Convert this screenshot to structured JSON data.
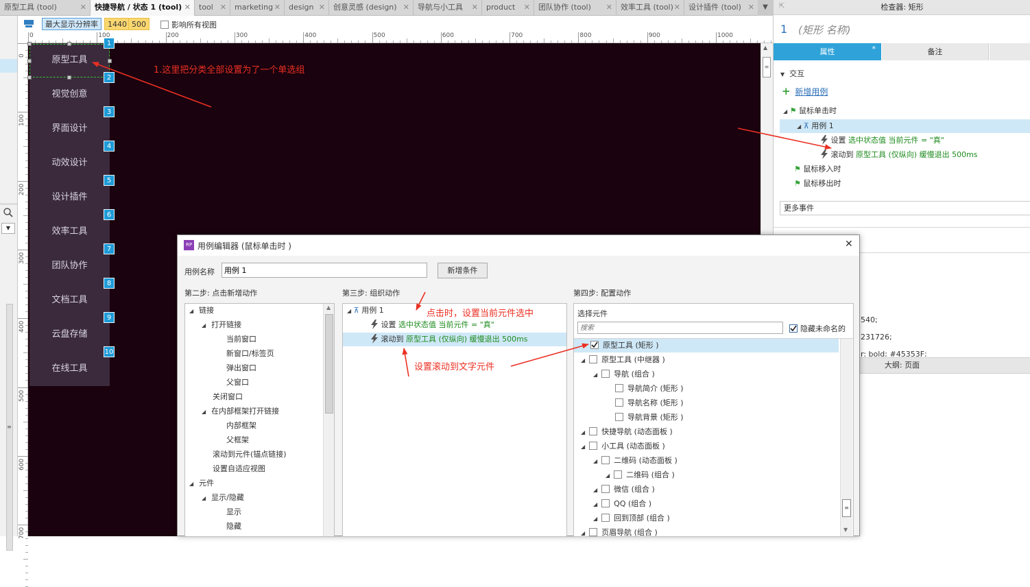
{
  "tabs": [
    {
      "label": "原型工具 (tool)",
      "active": false
    },
    {
      "label": "快捷导航 / 状态 1 (tool)",
      "active": true
    },
    {
      "label": "tool",
      "active": false
    },
    {
      "label": "marketing",
      "active": false
    },
    {
      "label": "design",
      "active": false
    },
    {
      "label": "创意灵感 (design)",
      "active": false
    },
    {
      "label": "导航与小工具",
      "active": false
    },
    {
      "label": "product",
      "active": false
    },
    {
      "label": "团队协作 (tool)",
      "active": false
    },
    {
      "label": "效率工具 (tool)",
      "active": false
    },
    {
      "label": "设计插件 (tool)",
      "active": false
    }
  ],
  "tab_close": "✕",
  "toolbar": {
    "resolution_label": "最大显示分辨率",
    "width": "1440",
    "height": "500",
    "affect_all_label": "影响所有视图"
  },
  "hruler": [
    "0",
    "100",
    "200",
    "300",
    "400",
    "500",
    "600",
    "700",
    "800",
    "900",
    "1000"
  ],
  "vruler": [
    "0",
    "100",
    "200",
    "300",
    "400",
    "500",
    "600",
    "700"
  ],
  "nav": {
    "items": [
      "原型工具",
      "视觉创意",
      "界面设计",
      "动效设计",
      "设计插件",
      "效率工具",
      "团队协作",
      "文档工具",
      "云盘存储",
      "在线工具"
    ],
    "numbers": [
      "1",
      "2",
      "3",
      "4",
      "5",
      "6",
      "7",
      "8",
      "9",
      "10"
    ]
  },
  "annotations": {
    "canvas_note": "1.这里把分类全部设置为了一个单选组",
    "click_note": "点击时，设置当前元件选中",
    "scroll_note": "设置滚动到文字元件"
  },
  "inspector": {
    "header": "检查器: 矩形",
    "index": "1",
    "name_placeholder": "(矩形 名称)",
    "tab_props": "属性",
    "tab_props_mark": "*",
    "tab_notes": "备注",
    "section_interaction": "交互",
    "add_case": "新增用例",
    "on_click": "鼠标单击时",
    "case_name": "用例 1",
    "action1_prefix": "设置",
    "action1_detail": "选中状态值 当前元件 = \"真\"",
    "action2_prefix": "滚动到",
    "action2_detail": "原型工具 (仅纵向) 缓慢退出 500ms",
    "on_enter": "鼠标移入时",
    "on_leave": "鼠标移出时",
    "more_events": "更多事件",
    "frag1": "540;",
    "frag2": "231726;",
    "frag3": "r: bold; #45353F;",
    "outline_header": "大纲: 页面"
  },
  "dialog": {
    "title": "用例编辑器 (鼠标单击时 )",
    "close": "✕",
    "case_name_label": "用例名称",
    "case_name_value": "用例 1",
    "add_condition": "新增条件",
    "step2": "第二步: 点击新增动作",
    "step3": "第三步: 组织动作",
    "step4": "第四步: 配置动作",
    "actions_tree": [
      {
        "label": "链接",
        "level": 0,
        "toggle": true
      },
      {
        "label": "打开链接",
        "level": 1,
        "toggle": true
      },
      {
        "label": "当前窗口",
        "level": 2,
        "toggle": false
      },
      {
        "label": "新窗口/标签页",
        "level": 2,
        "toggle": false
      },
      {
        "label": "弹出窗口",
        "level": 2,
        "toggle": false
      },
      {
        "label": "父窗口",
        "level": 2,
        "toggle": false
      },
      {
        "label": "关闭窗口",
        "level": 1,
        "toggle": false
      },
      {
        "label": "在内部框架打开链接",
        "level": 1,
        "toggle": true
      },
      {
        "label": "内部框架",
        "level": 2,
        "toggle": false
      },
      {
        "label": "父框架",
        "level": 2,
        "toggle": false
      },
      {
        "label": "滚动到元件(锚点链接)",
        "level": 1,
        "toggle": false
      },
      {
        "label": "设置自适应视图",
        "level": 1,
        "toggle": false
      },
      {
        "label": "元件",
        "level": 0,
        "toggle": true
      },
      {
        "label": "显示/隐藏",
        "level": 1,
        "toggle": true
      },
      {
        "label": "显示",
        "level": 2,
        "toggle": false
      },
      {
        "label": "隐藏",
        "level": 2,
        "toggle": false
      }
    ],
    "organize": {
      "case": "用例 1",
      "a1_prefix": "设置",
      "a1_detail": "选中状态值 当前元件 = \"真\"",
      "a2_prefix": "滚动到",
      "a2_detail": "原型工具 (仅纵向) 缓慢退出 500ms"
    },
    "select_widget_label": "选择元件",
    "search_placeholder": "搜索",
    "hide_unnamed": "隐藏未命名的",
    "widgets": [
      {
        "label": "原型工具 (矩形 )",
        "indent": 1,
        "toggle": false,
        "checked": true,
        "selected": true
      },
      {
        "label": "原型工具 (中继器 )",
        "indent": 1,
        "toggle": true,
        "checked": false,
        "selected": false
      },
      {
        "label": "导航 (组合 )",
        "indent": 2,
        "toggle": true,
        "checked": false,
        "selected": false
      },
      {
        "label": "导航简介 (矩形 )",
        "indent": 3,
        "toggle": false,
        "checked": false,
        "selected": false
      },
      {
        "label": "导航名称 (矩形 )",
        "indent": 3,
        "toggle": false,
        "checked": false,
        "selected": false
      },
      {
        "label": "导航背景 (矩形 )",
        "indent": 3,
        "toggle": false,
        "checked": false,
        "selected": false
      },
      {
        "label": "快捷导航 (动态面板 )",
        "indent": 1,
        "toggle": true,
        "checked": false,
        "selected": false
      },
      {
        "label": "小工具 (动态面板 )",
        "indent": 1,
        "toggle": true,
        "checked": false,
        "selected": false
      },
      {
        "label": "二维码 (动态面板 )",
        "indent": 2,
        "toggle": true,
        "checked": false,
        "selected": false
      },
      {
        "label": "二维码 (组合 )",
        "indent": 3,
        "toggle": true,
        "checked": false,
        "selected": false
      },
      {
        "label": "微信 (组合 )",
        "indent": 2,
        "toggle": true,
        "checked": false,
        "selected": false
      },
      {
        "label": "QQ (组合 )",
        "indent": 2,
        "toggle": true,
        "checked": false,
        "selected": false
      },
      {
        "label": "回到顶部 (组合 )",
        "indent": 2,
        "toggle": true,
        "checked": false,
        "selected": false
      },
      {
        "label": "页眉导航 (组合 )",
        "indent": 1,
        "toggle": true,
        "checked": false,
        "selected": false
      }
    ]
  },
  "colors": {
    "canvas_bg": "#1a020e",
    "nav_bg": "#3b2a3c",
    "badge": "#1e9bd7",
    "accent_blue": "#2fa3d9",
    "green": "#1f8b1f",
    "annotation_red": "#ea3023"
  }
}
